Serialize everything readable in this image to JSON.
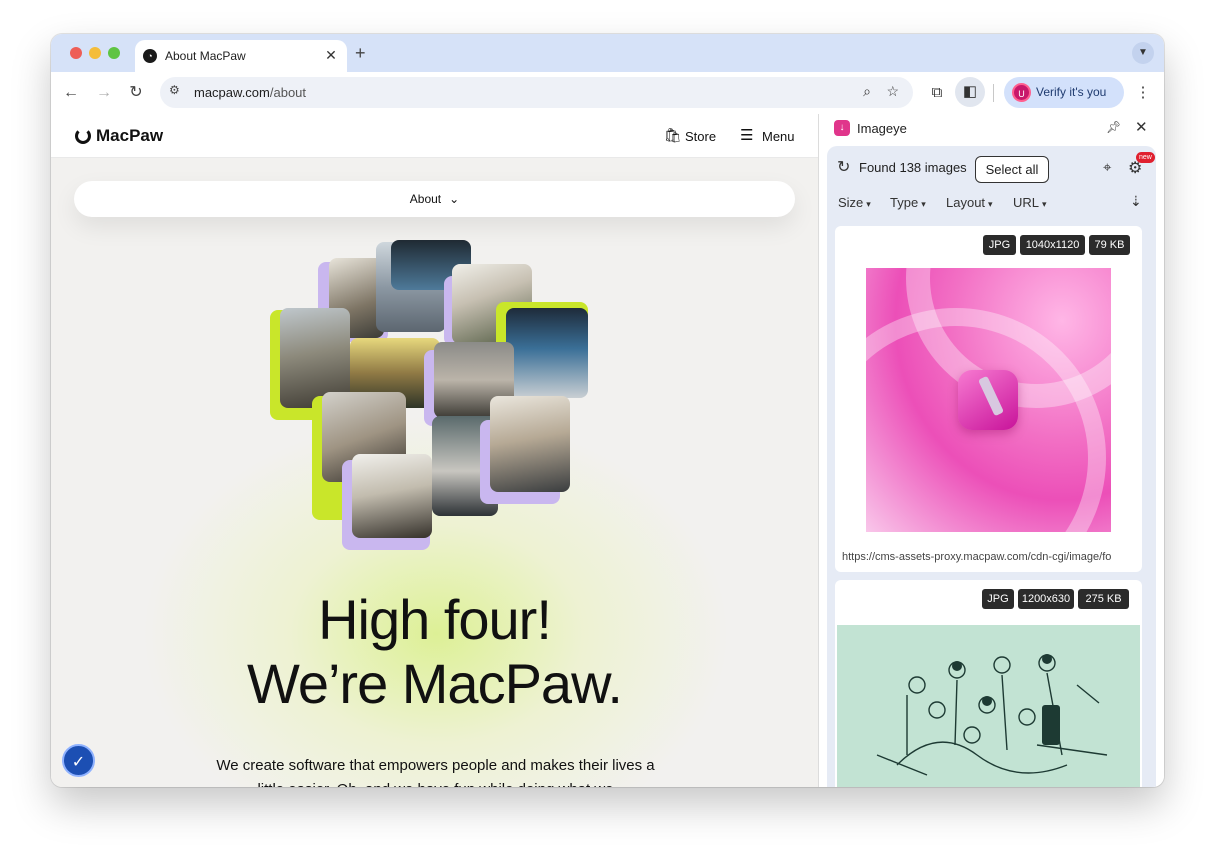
{
  "browser": {
    "tab_title": "About MacPaw",
    "tab_close": "✕",
    "new_tab": "+",
    "url_host": "macpaw.com",
    "url_path": "/about",
    "profile_initial": "U",
    "verify_label": "Verify it's you"
  },
  "site": {
    "logo": "MacPaw",
    "store_label": "Store",
    "menu_label": "Menu",
    "about_label": "About",
    "hero_line1": "High four!",
    "hero_line2": "We’re MacPaw.",
    "hero_sub": "We create software that empowers people and makes their lives a little easier. Oh, and we have fun while doing what we"
  },
  "panel": {
    "title": "Imageye",
    "found_text": "Found 138 images",
    "select_all": "Select all",
    "new_badge": "new",
    "filters": [
      "Size",
      "Type",
      "Layout",
      "URL"
    ],
    "cards": [
      {
        "format": "JPG",
        "dimensions": "1040x1120",
        "size": "79 KB",
        "url": "https://cms-assets-proxy.macpaw.com/cdn-cgi/image/fo"
      },
      {
        "format": "JPG",
        "dimensions": "1200x630",
        "size": "275 KB"
      }
    ]
  },
  "icons": {
    "back": "arrow-left-icon",
    "forward": "arrow-right-icon",
    "reload": "reload-icon",
    "zoom": "magnifier-icon",
    "bookmark": "star-icon",
    "extensions": "puzzle-icon",
    "side_panel": "side-panel-icon",
    "more": "kebab-icon",
    "store": "bag-icon",
    "menu": "hamburger-icon",
    "pin": "pin-icon",
    "close": "close-icon",
    "refresh": "refresh-icon",
    "crosshair": "crosshair-icon",
    "settings": "gear-icon",
    "sort": "sort-icon",
    "accessibility": "accessibility-icon"
  },
  "colors": {
    "tabstrip": "#d6e2f8",
    "accent_lime": "#c9e62a",
    "accent_lilac": "#c9b7ef",
    "imageye_brand": "#e0358b",
    "panel_bg": "#e6ebf5"
  }
}
